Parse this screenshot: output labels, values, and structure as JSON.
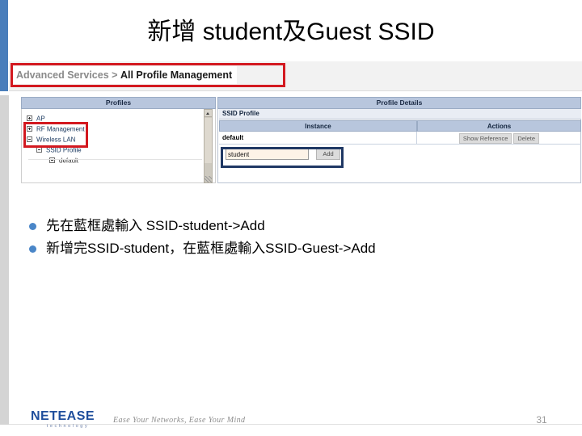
{
  "slide": {
    "title": "新增 student及Guest SSID",
    "page_number": "31",
    "accent_blue": "#4a7ebb",
    "highlight_red": "#d31920",
    "highlight_navy": "#1f3864"
  },
  "app_screenshot": {
    "breadcrumb": {
      "parent": "Advanced Services",
      "separator": ">",
      "current": "All Profile Management"
    },
    "panels": {
      "left_header": "Profiles",
      "right_header": "Profile Details"
    },
    "tree": {
      "items": [
        {
          "label": "AP",
          "state": "collapsed",
          "indent": 0
        },
        {
          "label": "RF Management",
          "state": "collapsed",
          "indent": 0
        },
        {
          "label": "Wireless LAN",
          "state": "expanded",
          "indent": 0
        },
        {
          "label": "SSID Profile",
          "state": "expanded",
          "indent": 1
        },
        {
          "label": "default",
          "state": "leaf",
          "indent": 2
        }
      ]
    },
    "details": {
      "section_title": "SSID Profile",
      "columns": [
        "Instance",
        "Actions"
      ],
      "rows": [
        {
          "instance": "default",
          "actions": [
            "Show Reference",
            "Delete"
          ]
        }
      ],
      "add_form": {
        "input_value": "student",
        "input_placeholder": "",
        "button_label": "Add"
      }
    }
  },
  "bullets": [
    "先在藍框處輸入 SSID-student->Add",
    "新增完SSID-student，在藍框處輸入SSID-Guest->Add"
  ],
  "footer": {
    "logo_name": "NETEASE",
    "logo_sub": "technology",
    "tagline": "Ease Your Networks, Ease Your Mind"
  }
}
